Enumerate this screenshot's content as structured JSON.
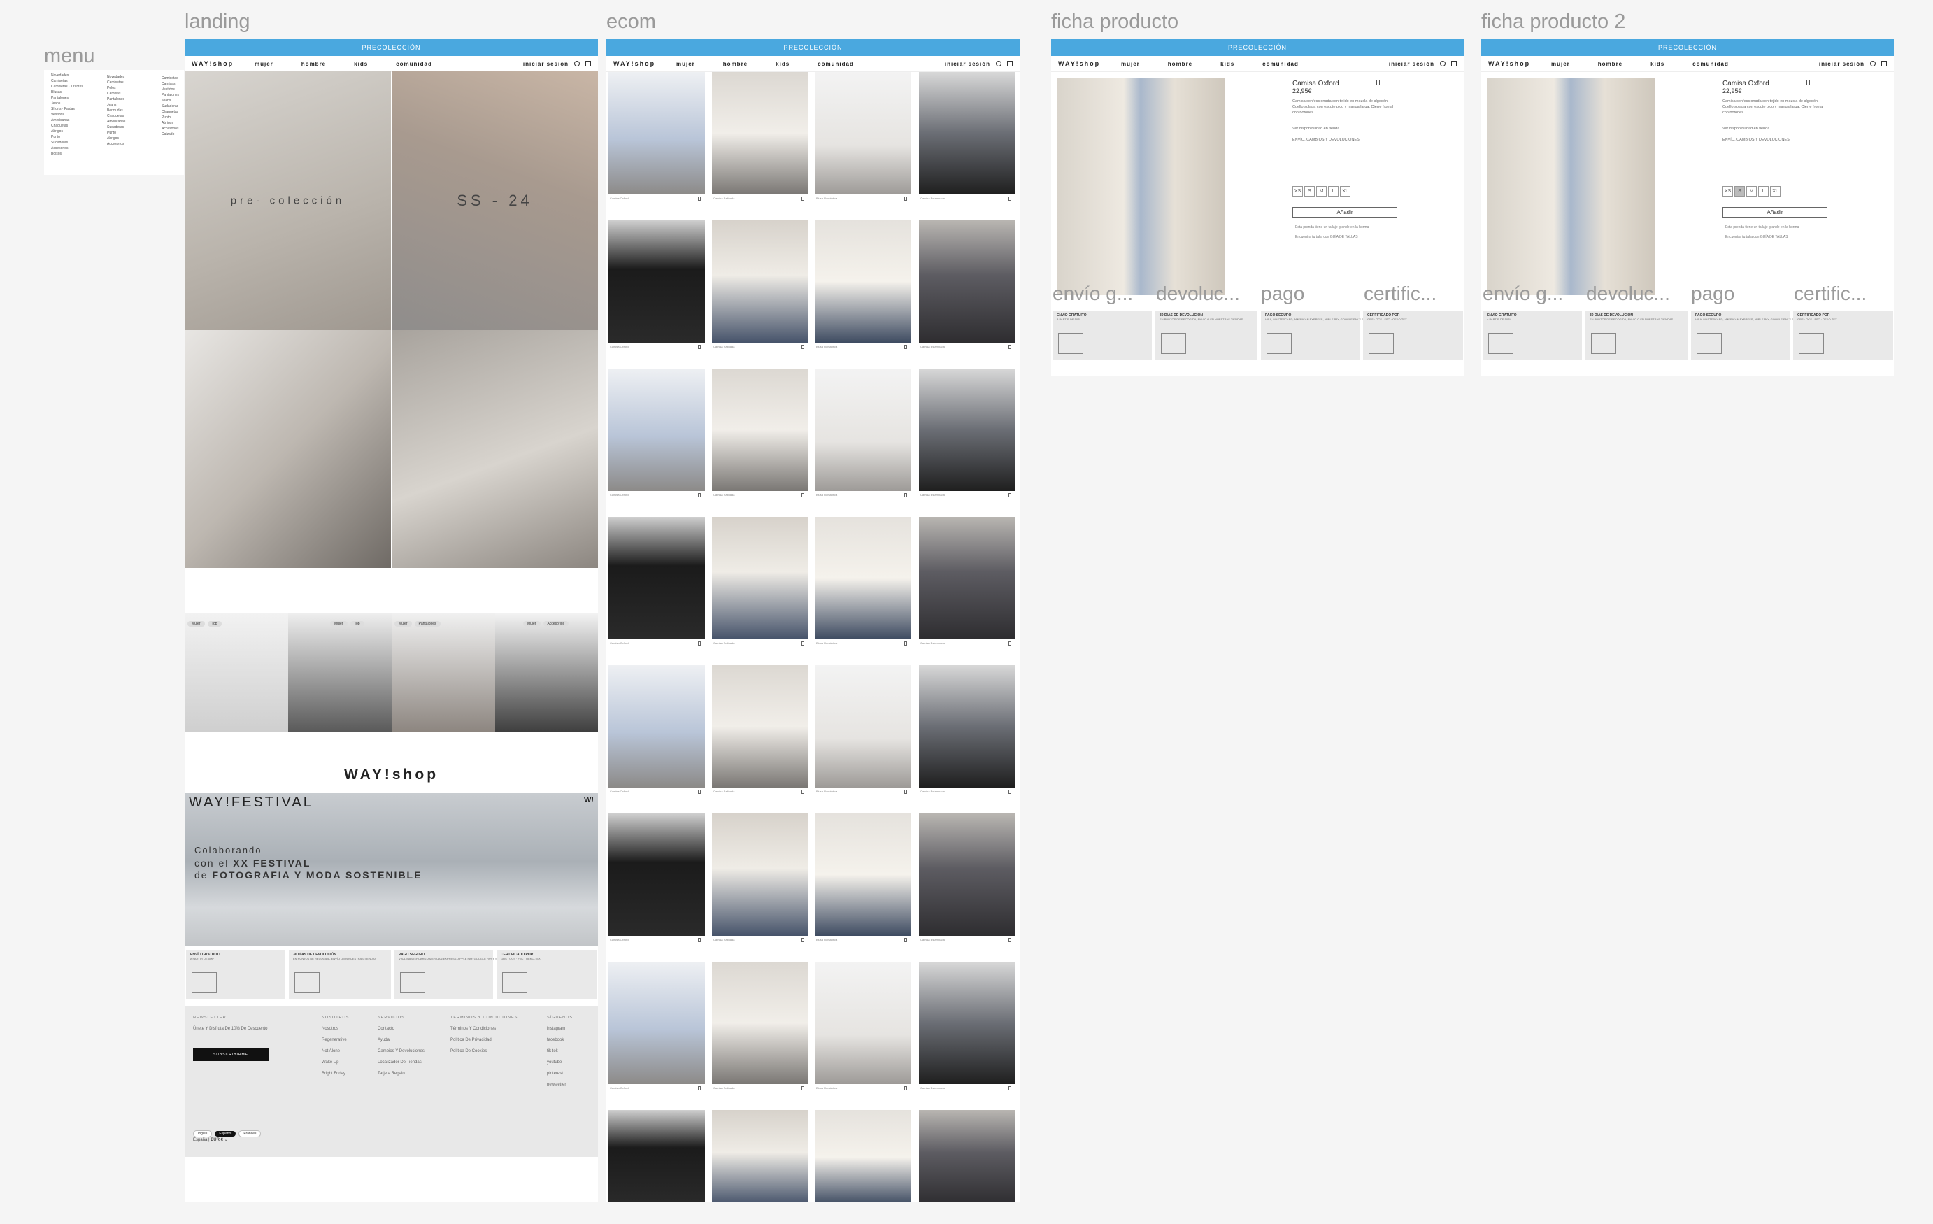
{
  "frames": {
    "menu": "menu",
    "landing": "landing",
    "ecom": "ecom",
    "ficha1": "ficha producto",
    "ficha2": "ficha producto 2"
  },
  "promo": "PRECOLECCIÓN",
  "nav": {
    "logo": "WAY!shop",
    "links": [
      "mujer",
      "hombre",
      "kids",
      "comunidad"
    ],
    "login": "iniciar sesión"
  },
  "menu": {
    "col1": [
      "Novedades",
      "Camisetas",
      "Camisetas · Tirantes",
      "Blusas",
      "Pantalones",
      "Jeans",
      "Shorts · Faldas",
      "Vestidos",
      "Americanas",
      "Chaquetas",
      "Abrigos",
      "Punto",
      "Sudaderas",
      "Accesorios",
      "Bolsos"
    ],
    "col2": [
      "Novedades",
      "Camisetas",
      "Polos",
      "Camisas",
      "Pantalones",
      "Jeans",
      "Bermudas",
      "Chaquetas",
      "Americanas",
      "Sudaderas",
      "Punto",
      "Abrigos",
      "Accesorios"
    ],
    "col3": [
      "Camisetas",
      "Camisas",
      "Vestidos",
      "Pantalones",
      "Jeans",
      "Sudaderas",
      "Chaquetas",
      "Punto",
      "Abrigos",
      "Accesorios",
      "Calzado"
    ]
  },
  "landing": {
    "hero_left_text": "pre- colección",
    "hero_right_text": "SS - 24",
    "chips": [
      [
        "Mujer",
        "Top"
      ],
      [
        "Mujer",
        "Top"
      ],
      [
        "Mujer",
        "Pantalones"
      ],
      [
        "Mujer",
        "Accesorios"
      ]
    ],
    "wayshop_logo": "WAY!shop",
    "festival_logo": "WAY!FESTIVAL",
    "festival_mark": "W!",
    "festival_line1": "Colaborando",
    "festival_line2_pre": "con el ",
    "festival_line2_bold": "XX FESTIVAL",
    "festival_line3_pre": "de ",
    "festival_line3_bold": "FOTOGRAFIA Y MODA SOSTENIBLE"
  },
  "features": [
    {
      "title": "ENVÍO GRATUITO",
      "sub": "A PARTIR DE 50€*"
    },
    {
      "title": "30 DÍAS DE DEVOLUCIÓN",
      "sub": "EN PUNTOS DE RECOGIDA, ENVÍO O EN NUESTRAS TIENDAS"
    },
    {
      "title": "PAGO SEGURO",
      "sub": "VISA, MASTERCARD, AMERICAN EXPRESS, APPLE PAY, GOOGLE PAY Y SHOP PAY"
    },
    {
      "title": "CERTIFICADO POR",
      "sub": "GRS · OCS · FSC · OEKO-TEX"
    }
  ],
  "footer": {
    "newsletter_h": "NEWSLETTER",
    "newsletter_text": "Únete Y Disfruta De 10% De Descuento",
    "subscribe": "SUBSCRIBIRME",
    "nosotros_h": "NOSOTROS",
    "nosotros": [
      "Nosotros",
      "Regenerative",
      "Not Alone",
      "Wake Up",
      "Bright Friday"
    ],
    "servicios_h": "SERVICIOS",
    "servicios": [
      "Contacto",
      "Ayuda",
      "Cambios Y Devoluciones",
      "Localizador De Tiendas",
      "Tarjeta Regalo"
    ],
    "terminos_h": "TÉRMINOS Y CONDICIONES",
    "terminos": [
      "Términos Y Condiciones",
      "Política De Privacidad",
      "Política De Cookies"
    ],
    "siguenos_h": "SÍGUENOS",
    "siguenos": [
      "instagram",
      "facebook",
      "tik tok",
      "youtube",
      "pinterest",
      "newsletter"
    ],
    "languages": [
      "Inglés",
      "Español",
      "Francés"
    ],
    "country": "España",
    "currency": "EUR €"
  },
  "product": {
    "name": "Camisa Oxford",
    "price": "22,95€",
    "desc": "Camisa confeccionada con tejido en mezcla de algodón. Cuello solapa con escote pico y manga larga. Cierre frontal con botones.",
    "availability": "Ver disponibilidad en tienda",
    "shipping": "ENVÍO, CAMBIOS Y DEVOLUCIONES",
    "sizes": [
      "XS",
      "S",
      "M",
      "L",
      "XL"
    ],
    "add": "Añadir",
    "note1": "Esta prenda tiene un tallaje grande en la horma",
    "note2": "Encuentra tu talla con GUÍA DE TALLAS",
    "sections": [
      "envío g...",
      "devoluc...",
      "pago",
      "certific..."
    ]
  },
  "ecom_labels": [
    "Camisa Oxford",
    "Camisa Satinada",
    "Blusa Romántica",
    "Camisa Estampada"
  ],
  "colors": {
    "promo": "#4aa8df",
    "footer": "#e8e8e8",
    "feature": "#e9e9e9"
  }
}
